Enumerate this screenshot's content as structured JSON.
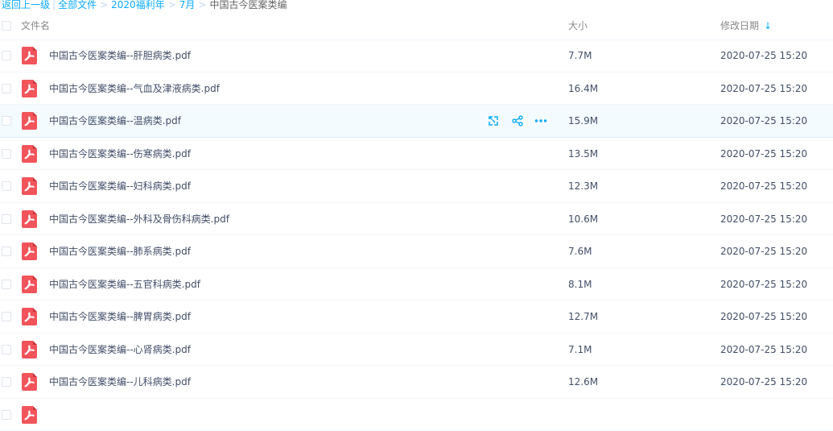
{
  "breadcrumb": {
    "back": "返回上一级",
    "all_files": "全部文件",
    "crumb_1": "2020福利年",
    "crumb_2": "7月",
    "current": "中国古今医案类编",
    "sep": ">"
  },
  "columns": {
    "name": "文件名",
    "size": "大小",
    "modified": "修改日期",
    "sort_indicator": "↓"
  },
  "files": [
    {
      "name": "中国古今医案类编--肝胆病类.pdf",
      "size": "7.7M",
      "date": "2020-07-25 15:20"
    },
    {
      "name": "中国古今医案类编--气血及津液病类.pdf",
      "size": "16.4M",
      "date": "2020-07-25 15:20"
    },
    {
      "name": "中国古今医案类编--温病类.pdf",
      "size": "15.9M",
      "date": "2020-07-25 15:20"
    },
    {
      "name": "中国古今医案类编--伤寒病类.pdf",
      "size": "13.5M",
      "date": "2020-07-25 15:20"
    },
    {
      "name": "中国古今医案类编--妇科病类.pdf",
      "size": "12.3M",
      "date": "2020-07-25 15:20"
    },
    {
      "name": "中国古今医案类编--外科及骨伤科病类.pdf",
      "size": "10.6M",
      "date": "2020-07-25 15:20"
    },
    {
      "name": "中国古今医案类编--肺系病类.pdf",
      "size": "7.6M",
      "date": "2020-07-25 15:20"
    },
    {
      "name": "中国古今医案类编--五官科病类.pdf",
      "size": "8.1M",
      "date": "2020-07-25 15:20"
    },
    {
      "name": "中国古今医案类编--脾胃病类.pdf",
      "size": "12.7M",
      "date": "2020-07-25 15:20"
    },
    {
      "name": "中国古今医案类编--心肾病类.pdf",
      "size": "7.1M",
      "date": "2020-07-25 15:20"
    },
    {
      "name": "中国古今医案类编--儿科病类.pdf",
      "size": "12.6M",
      "date": "2020-07-25 15:20"
    },
    {
      "name": "",
      "size": "",
      "date": ""
    }
  ],
  "hover_row": 2,
  "colors": {
    "link": "#09aaff",
    "pdf_icon": "#f2545b",
    "hover_bg": "#f4fbff",
    "text": "#424e67"
  },
  "icons": {
    "file_type": "pdf-icon",
    "row_actions": [
      "link-share-icon",
      "share-icon",
      "more-icon"
    ]
  }
}
